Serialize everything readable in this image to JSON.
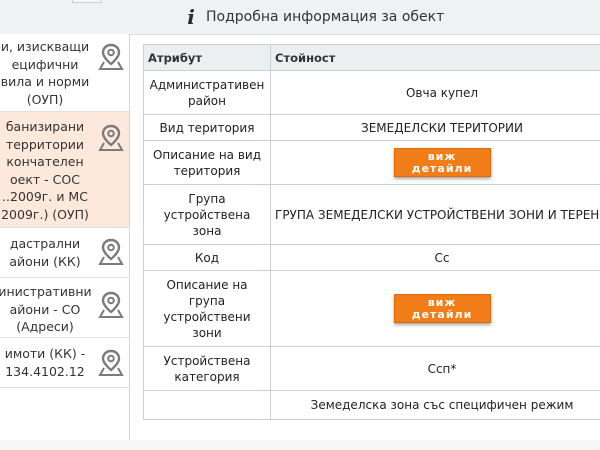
{
  "header": {
    "title": "Подробна информация за обект",
    "icon": "info-icon"
  },
  "sidebar": {
    "items": [
      {
        "label": "и, изискващи\nецифични\nвила и норми\n(ОУП)",
        "icon": "map-pin-icon",
        "selected": false
      },
      {
        "label": "банизирани\nтерритории\nкончателен\nоект - СОС\n..2009г. и МС\n2009г.) (ОУП)",
        "icon": "map-pin-icon",
        "selected": true
      },
      {
        "label": "дастрални\nайони (КК)",
        "icon": "map-pin-icon",
        "selected": false
      },
      {
        "label": "инистративни\nайони - СО\n(Адреси)",
        "icon": "map-pin-icon",
        "selected": false
      },
      {
        "label": "имоти (КК) -\n134.4102.12",
        "icon": "map-pin-icon",
        "selected": false
      }
    ]
  },
  "table": {
    "headers": {
      "attribute": "Атрибут",
      "value": "Стойност"
    },
    "button_label_line1": "виж",
    "button_label_line2": "детайли",
    "rows": [
      {
        "attribute": "Административен\nрайон",
        "value": "Овча купел"
      },
      {
        "attribute": "Вид територия",
        "value": "ЗЕМЕДЕЛСКИ ТЕРИТОРИИ"
      },
      {
        "attribute": "Описание на вид\nтеритория",
        "value": ""
      },
      {
        "attribute": "Група\nустройствена\nзона",
        "value": "ГРУПА ЗЕМЕДЕЛСКИ УСТРОЙСТВЕНИ ЗОНИ И ТЕРЕНИ"
      },
      {
        "attribute": "Код",
        "value": "Сс"
      },
      {
        "attribute": "Описание на\nгрупа\nустройствени\nзони",
        "value": ""
      },
      {
        "attribute": "Устройствена\nкатегория",
        "value": "Сcп*"
      },
      {
        "attribute": "",
        "value": "Земеделска зона със специфичен режим"
      }
    ]
  },
  "colors": {
    "button": "#f07d17",
    "selected_item": "#fde8dc",
    "header_bg": "#eef2f3"
  }
}
